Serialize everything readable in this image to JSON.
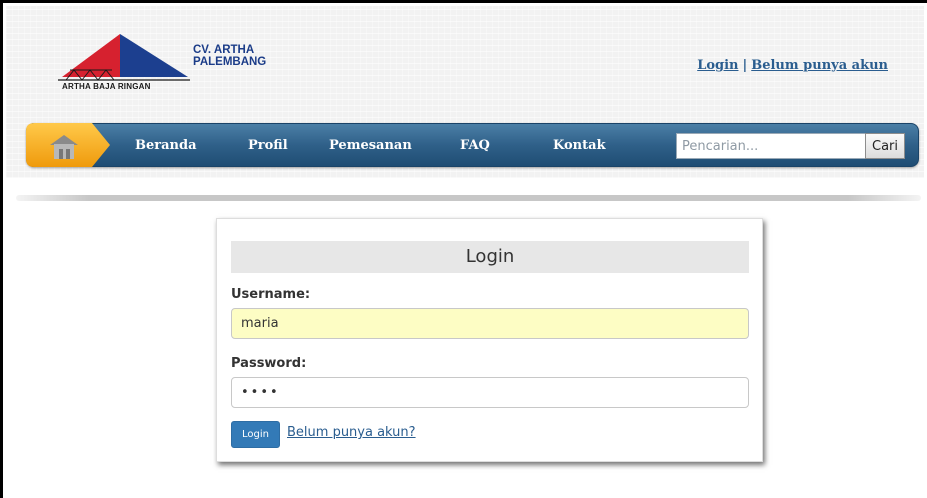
{
  "brand": {
    "logo_text": "ARTHA BAJA RINGAN",
    "company_line1": "CV. ARTHA",
    "company_line2": "PALEMBANG"
  },
  "top_links": {
    "login": "Login",
    "separator": "|",
    "register": "Belum punya akun"
  },
  "nav": {
    "items": [
      "Beranda",
      "Profil",
      "Pemesanan",
      "FAQ",
      "Kontak"
    ],
    "search_placeholder": "Pencarian...",
    "search_button": "Cari"
  },
  "login_form": {
    "title": "Login",
    "username_label": "Username:",
    "username_value": "maria",
    "password_label": "Password:",
    "password_value": "••••",
    "submit_label": "Login",
    "register_link": "Belum punya akun?"
  },
  "colors": {
    "nav_blue": "#2f6089",
    "home_orange": "#f5a623",
    "primary_button": "#337ab7",
    "link_blue": "#2a5d8f",
    "autofill_yellow": "#fdfdc4"
  }
}
